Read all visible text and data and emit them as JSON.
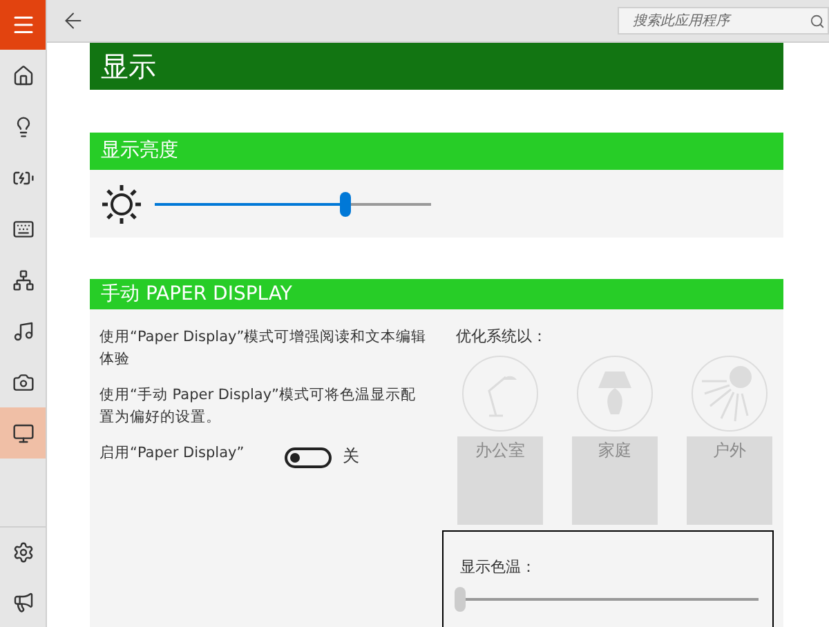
{
  "search": {
    "placeholder": "搜索此应用程序"
  },
  "sidebar": {
    "items": [
      {
        "kind": "home",
        "selected": false
      },
      {
        "kind": "lightbulb",
        "selected": false
      },
      {
        "kind": "battery",
        "selected": false
      },
      {
        "kind": "keyboard",
        "selected": false
      },
      {
        "kind": "network",
        "selected": false
      },
      {
        "kind": "music",
        "selected": false
      },
      {
        "kind": "camera",
        "selected": false
      },
      {
        "kind": "monitor",
        "selected": true
      }
    ],
    "bottom_items": [
      {
        "kind": "settings"
      },
      {
        "kind": "megaphone"
      }
    ]
  },
  "page_title": "显示",
  "brightness": {
    "title": "显示亮度",
    "level": 0.69
  },
  "paper_display": {
    "title": "手动 PAPER DISPLAY",
    "descriptions": [
      "使用“Paper Display”模式可增强阅读和文本编辑体验",
      "使用“手动 Paper Display”模式可将色温显示配置为偏好的设置。"
    ],
    "toggle": {
      "label": "启用“Paper Display”",
      "on": false,
      "state_text": "关"
    },
    "optimize_label": "优化系统以：",
    "options": [
      {
        "kind": "desk-lamp",
        "label": "办公室",
        "disabled": true
      },
      {
        "kind": "table-lamp",
        "label": "家庭",
        "disabled": true
      },
      {
        "kind": "sun",
        "label": "户外",
        "disabled": true
      }
    ],
    "color_temperature": {
      "label": "显示色温：",
      "level": 0
    }
  }
}
